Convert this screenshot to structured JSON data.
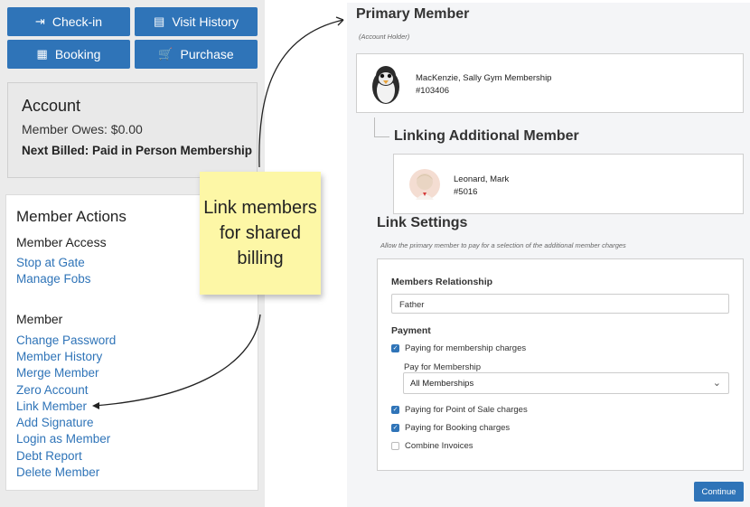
{
  "left": {
    "buttons": {
      "checkin": "Check-in",
      "visit_history": "Visit History",
      "booking": "Booking",
      "purchase": "Purchase"
    },
    "account": {
      "title": "Account",
      "owes": "Member Owes: $0.00",
      "next_billed": "Next Billed: Paid in Person Membership"
    },
    "actions": {
      "title": "Member Actions",
      "access_heading": "Member Access",
      "access_links": [
        "Stop at Gate",
        "Manage Fobs"
      ],
      "member_heading": "Member",
      "member_links": [
        "Change Password",
        "Member History",
        "Merge Member",
        "Zero Account",
        "Link Member",
        "Add Signature",
        "Login as Member",
        "Debt Report",
        "Delete Member"
      ]
    }
  },
  "sticky_note": "Link members for shared billing",
  "right": {
    "primary_heading": "Primary Member",
    "account_holder": "(Account Holder)",
    "primary_member": {
      "name": "MacKenzie, Sally Gym Membership",
      "id": "#103406"
    },
    "linking_heading": "Linking Additional Member",
    "linked_member": {
      "name": "Leonard, Mark",
      "id": "#5016"
    },
    "settings_heading": "Link Settings",
    "settings_desc": "Allow the primary member to pay for a selection of the additional member charges",
    "relationship_label": "Members Relationship",
    "relationship_value": "Father",
    "payment_label": "Payment",
    "paying_membership": "Paying for membership charges",
    "pay_for_membership_label": "Pay for Membership",
    "pay_for_membership_value": "All Memberships",
    "paying_pos": "Paying for Point of Sale charges",
    "paying_booking": "Paying for Booking charges",
    "combine_invoices": "Combine Invoices",
    "continue": "Continue"
  },
  "checkboxes": {
    "paying_membership": true,
    "paying_pos": true,
    "paying_booking": true,
    "combine_invoices": false
  },
  "colors": {
    "primary_blue": "#2f74b8",
    "sticky_yellow": "#fdf7a6",
    "panel_gray": "#ebebeb"
  },
  "icons": [
    "checkin-icon",
    "visit-history-icon",
    "booking-icon",
    "purchase-icon",
    "penguin-avatar",
    "person-avatar",
    "chevron-down-icon",
    "check-icon"
  ]
}
